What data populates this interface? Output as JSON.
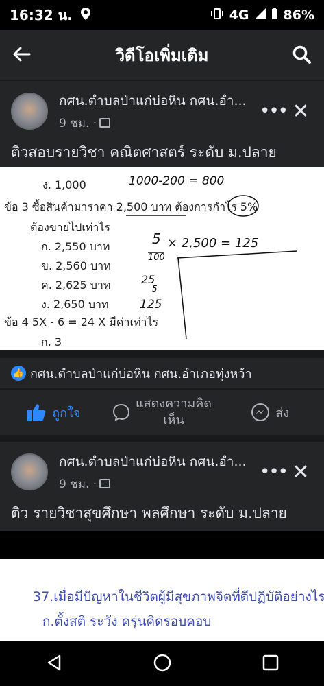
{
  "status_bar": {
    "time": "16:32 น.",
    "network": "4G",
    "battery": "86%"
  },
  "app_bar": {
    "title": "วิดีโอเพิ่มเติม"
  },
  "post1": {
    "author": "กศน.ตำบลป่าแก่บ่อหิน กศน.อำ...",
    "time": "9 ชม. ·",
    "caption": "ติวสอบรายวิชา คณิตศาสตร์ ระดับ ม.ปลาย",
    "video": {
      "line_top": "ง.   1,000",
      "hand_top": "1000-200 = 800",
      "q3": "ข้อ 3  ซื้อสินค้ามาราคา  2,500  บาท  ต้องการกำไร 5%",
      "q3_sub": "ต้องขายไปเท่าไร",
      "opt_a": "ก.  2,550  บาท",
      "opt_b": "ข.  2,560  บาท",
      "opt_c": "ค.  2,625  บาท",
      "opt_d": "ง.  2,650  บาท",
      "q4": "ข้อ 4   5X - 6  =  24  X  มีค่าเท่าไร",
      "q4_a": "ก.   3",
      "hand_num": "5",
      "hand_den": "100",
      "hand_eq": "× 2,500 = 125",
      "hand_25": "25",
      "hand_5": "5",
      "hand_125": "125"
    },
    "page_name": "กศน.ตำบลป่าแก่บ่อหิน กศน.อำเภอทุ่งหว้า",
    "actions": {
      "like": "ถูกใจ",
      "comment": "แสดงความคิด\nเห็น",
      "share": "ส่ง"
    }
  },
  "post2": {
    "author": "กศน.ตำบลป่าแก่บ่อหิน กศน.อำ...",
    "time": "9 ชม. ·",
    "caption": "ติว รายวิชาสุขศึกษา พลศึกษา ระดับ ม.ปลาย",
    "thumb_line1": "37.เมื่อมีปัญหาในชีวิตผู้มีสุขภาพจิตที่ดีปฏิบัติอย่างไร",
    "thumb_line2": "ก.ตั้งสติ ระวัง ครุ่นคิดรอบคอบ"
  },
  "colors": {
    "accent": "#2d88ff",
    "background": "#18191a",
    "surface": "#242526"
  }
}
